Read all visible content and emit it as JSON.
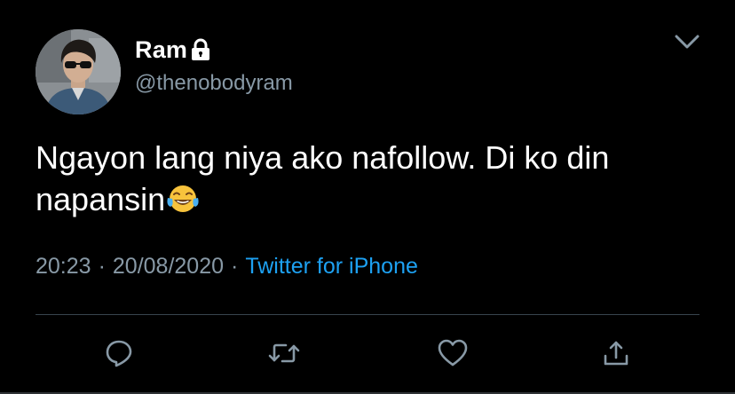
{
  "user": {
    "display_name": "Ram",
    "handle": "@thenobodyram",
    "protected_icon": "lock-icon",
    "avatar_icon": "avatar"
  },
  "tweet": {
    "text": "Ngayon lang niya ako nafollow. Di ko din napansin",
    "emoji_icon": "face-with-tears-of-joy-icon"
  },
  "meta": {
    "time": "20:23",
    "separator": "·",
    "date": "20/08/2020",
    "source": "Twitter for iPhone"
  },
  "actions": {
    "reply_icon": "reply-icon",
    "retweet_icon": "retweet-icon",
    "like_icon": "heart-icon",
    "share_icon": "share-icon"
  },
  "colors": {
    "background": "#000000",
    "text": "#ffffff",
    "muted": "#8899a6",
    "link": "#1da1f2",
    "divider": "#38444d"
  }
}
